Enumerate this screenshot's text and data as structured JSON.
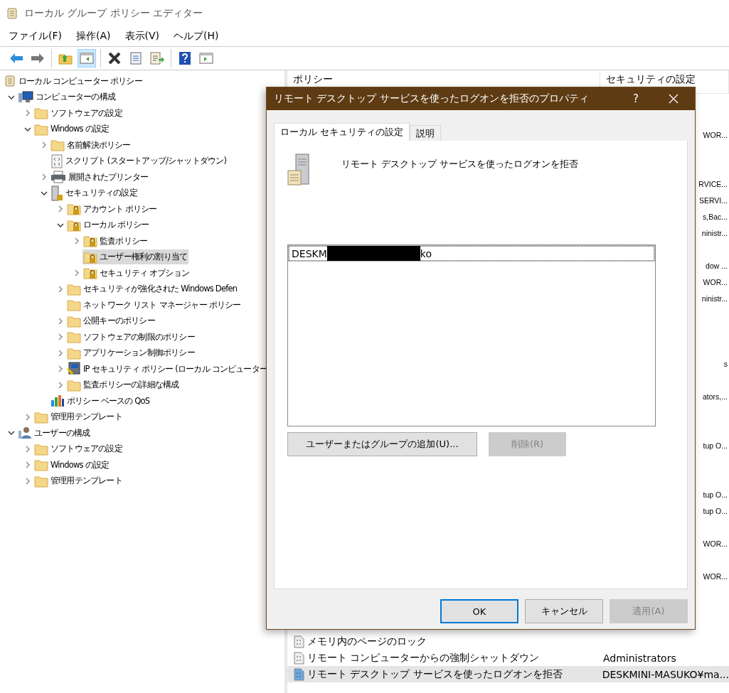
{
  "window": {
    "title": "ローカル グループ ポリシー エディター"
  },
  "menu": [
    "ファイル(F)",
    "操作(A)",
    "表示(V)",
    "ヘルプ(H)"
  ],
  "toolbar": [
    [
      {
        "kind": "back",
        "pressed": false
      },
      {
        "kind": "forward",
        "pressed": false
      }
    ],
    [
      {
        "kind": "up-folder",
        "pressed": false
      },
      {
        "kind": "tree-pane",
        "pressed": true
      }
    ],
    [
      {
        "kind": "delete",
        "pressed": false
      },
      {
        "kind": "properties",
        "pressed": false
      },
      {
        "kind": "export",
        "pressed": false
      }
    ],
    [
      {
        "kind": "help",
        "pressed": false
      },
      {
        "kind": "action-pane",
        "pressed": false
      }
    ]
  ],
  "tree": [
    {
      "label": "ローカル コンピューター ポリシー",
      "kind": "scroll",
      "selected": false,
      "children": [
        {
          "label": "コンピューターの構成",
          "kind": "computer",
          "expanded": true,
          "selected": false,
          "children": [
            {
              "label": "ソフトウェアの設定",
              "kind": "folder",
              "expanded": false,
              "selected": false
            },
            {
              "label": "Windows の設定",
              "kind": "folder",
              "expanded": true,
              "selected": false,
              "children": [
                {
                  "label": "名前解決ポリシー",
                  "kind": "folder",
                  "expanded": false,
                  "selected": false
                },
                {
                  "label": "スクリプト (スタートアップ/シャットダウン)",
                  "kind": "script",
                  "selected": false
                },
                {
                  "label": "展開されたプリンター",
                  "kind": "printer",
                  "expanded": false,
                  "selected": false
                },
                {
                  "label": "セキュリティの設定",
                  "kind": "server-lock",
                  "expanded": true,
                  "selected": false,
                  "children": [
                    {
                      "label": "アカウント ポリシー",
                      "kind": "folder-lock",
                      "expanded": false,
                      "selected": false
                    },
                    {
                      "label": "ローカル ポリシー",
                      "kind": "folder-lock",
                      "expanded": true,
                      "selected": false,
                      "children": [
                        {
                          "label": "監査ポリシー",
                          "kind": "folder-lock",
                          "expanded": false,
                          "selected": false
                        },
                        {
                          "label": "ユーザー権利の割り当て",
                          "kind": "folder-lock",
                          "selected": true
                        },
                        {
                          "label": "セキュリティ オプション",
                          "kind": "folder-lock",
                          "expanded": false,
                          "selected": false
                        }
                      ]
                    },
                    {
                      "label": "セキュリティが強化された Windows Defen",
                      "kind": "folder",
                      "expanded": false,
                      "selected": false
                    },
                    {
                      "label": "ネットワーク リスト マネージャー ポリシー",
                      "kind": "folder",
                      "selected": false
                    },
                    {
                      "label": "公開キーのポリシー",
                      "kind": "folder",
                      "expanded": false,
                      "selected": false
                    },
                    {
                      "label": "ソフトウェアの制限のポリシー",
                      "kind": "folder",
                      "expanded": false,
                      "selected": false
                    },
                    {
                      "label": "アプリケーション制御ポリシー",
                      "kind": "folder",
                      "expanded": false,
                      "selected": false
                    },
                    {
                      "label": "IP セキュリティ ポリシー (ローカル コンピューター",
                      "kind": "ipsec",
                      "expanded": false,
                      "selected": false
                    },
                    {
                      "label": "監査ポリシーの詳細な構成",
                      "kind": "folder",
                      "expanded": false,
                      "selected": false
                    }
                  ]
                },
                {
                  "label": "ポリシー ベースの QoS",
                  "kind": "chart",
                  "selected": false
                }
              ]
            },
            {
              "label": "管理用テンプレート",
              "kind": "folder",
              "expanded": false,
              "selected": false
            }
          ]
        },
        {
          "label": "ユーザーの構成",
          "kind": "user",
          "expanded": true,
          "selected": false,
          "children": [
            {
              "label": "ソフトウェアの設定",
              "kind": "folder",
              "expanded": false,
              "selected": false
            },
            {
              "label": "Windows の設定",
              "kind": "folder",
              "expanded": false,
              "selected": false
            },
            {
              "label": "管理用テンプレート",
              "kind": "folder",
              "expanded": false,
              "selected": false
            }
          ]
        }
      ]
    }
  ],
  "list": {
    "columns": [
      "ポリシー",
      "セキュリティの設定"
    ],
    "rows": [
      {
        "selected": false
      },
      {
        "selected": false
      },
      {
        "setting": "WOR...",
        "selected": false
      },
      {
        "selected": false
      },
      {
        "selected": false
      },
      {
        "setting": "RVICE...",
        "selected": false
      },
      {
        "setting": "SERVI...",
        "selected": false
      },
      {
        "setting": "s,Bac...",
        "selected": false
      },
      {
        "setting": "ninistr...",
        "selected": false
      },
      {
        "selected": false
      },
      {
        "setting": "dow ...",
        "selected": false
      },
      {
        "setting": "WOR...",
        "selected": false
      },
      {
        "setting": "ninistr...",
        "selected": false
      },
      {
        "selected": false
      },
      {
        "selected": false
      },
      {
        "selected": false
      },
      {
        "setting": "s",
        "selected": false
      },
      {
        "selected": false
      },
      {
        "setting": "ators,...",
        "selected": false
      },
      {
        "selected": false
      },
      {
        "selected": false
      },
      {
        "setting": "tup O...",
        "selected": false
      },
      {
        "selected": false
      },
      {
        "selected": false
      },
      {
        "setting": "tup O...",
        "selected": false
      },
      {
        "setting": "tup O...",
        "selected": false
      },
      {
        "selected": false
      },
      {
        "setting": "WOR...",
        "selected": false
      },
      {
        "selected": false
      },
      {
        "setting": "WOR...",
        "selected": false
      },
      {
        "selected": false
      },
      {
        "selected": false
      },
      {
        "selected": false
      },
      {
        "name": "メモリ内のページのロック",
        "selected": false
      },
      {
        "name": "リモート コンピューターからの強制シャットダウン",
        "setting": "Administrators",
        "selected": false
      },
      {
        "name": "リモート デスクトップ サービスを使ったログオンを拒否",
        "setting": "DESKMINI-MASUKO¥ma...",
        "selected": true
      }
    ]
  },
  "dialog": {
    "title": "リモート デスクトップ サービスを使ったログオンを拒否のプロパティ",
    "help_label": "?",
    "tabs": [
      {
        "label": "ローカル セキュリティの設定",
        "selected": true
      },
      {
        "label": "説明",
        "selected": false
      }
    ],
    "heading": "リモート デスクトップ サービスを使ったログオンを拒否",
    "entries": [
      {
        "before": "DESKM",
        "after": "ko",
        "redacted": true,
        "focused": true
      }
    ],
    "add_button": {
      "label": "ユーザーまたはグループの追加(U)...",
      "disabled": false
    },
    "remove_button": {
      "label": "削除(R)",
      "disabled": true
    },
    "buttons": [
      {
        "label": "OK",
        "default": true,
        "disabled": false
      },
      {
        "label": "キャンセル",
        "default": false,
        "disabled": false
      },
      {
        "label": "適用(A)",
        "default": false,
        "disabled": true
      }
    ]
  }
}
